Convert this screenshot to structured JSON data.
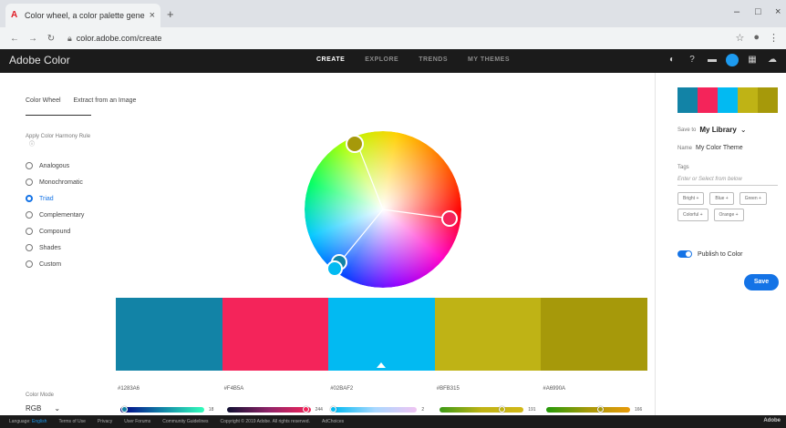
{
  "browser": {
    "tab_title": "Color wheel, a color palette gene",
    "tab_icon": "adobe-icon",
    "url": "color.adobe.com/create"
  },
  "app": {
    "brand": "Adobe Color",
    "nav": [
      "CREATE",
      "EXPLORE",
      "TRENDS",
      "MY THEMES"
    ],
    "active_nav": "CREATE"
  },
  "subtabs": [
    "Color Wheel",
    "Extract from an Image"
  ],
  "harmony": {
    "label": "Apply Color Harmony Rule",
    "rules": [
      "Analogous",
      "Monochromatic",
      "Triad",
      "Complementary",
      "Compound",
      "Shades",
      "Custom"
    ],
    "selected": "Triad"
  },
  "swatches": [
    {
      "hex": "#1283A6",
      "color": "#1283a6",
      "slider_value": "18",
      "slider_fraction": 0.05
    },
    {
      "hex": "#F4B5A",
      "color": "#f4245a",
      "slider_value": "244",
      "slider_fraction": 0.95
    },
    {
      "hex": "#02BAF2",
      "color": "#02baf2",
      "slider_value": "2",
      "slider_fraction": 0.0
    },
    {
      "hex": "#BFB315",
      "color": "#bfb315",
      "slider_value": "191",
      "slider_fraction": 0.75
    },
    {
      "hex": "#A6990A",
      "color": "#a6990a",
      "slider_value": "166",
      "slider_fraction": 0.65
    }
  ],
  "color_mode": {
    "label": "Color Mode",
    "value": "RGB"
  },
  "right_panel": {
    "save_to_label": "Save to",
    "library": "My Library",
    "name_label": "Name",
    "name_value": "My Color Theme",
    "tags_label": "Tags",
    "tags_placeholder": "Enter or Select from below",
    "tags": [
      "Bright +",
      "Blue +",
      "Green +",
      "Colorful +",
      "Orange +"
    ],
    "publish_label": "Publish to Color",
    "save_button": "Save"
  },
  "footer": {
    "language_label": "Language:",
    "language": "English",
    "links": [
      "Terms of Use",
      "Privacy",
      "User Forums",
      "Community Guidelines",
      "Copyright © 2019 Adobe. All rights reserved.",
      "AdChoices"
    ],
    "logo": "Adobe"
  }
}
